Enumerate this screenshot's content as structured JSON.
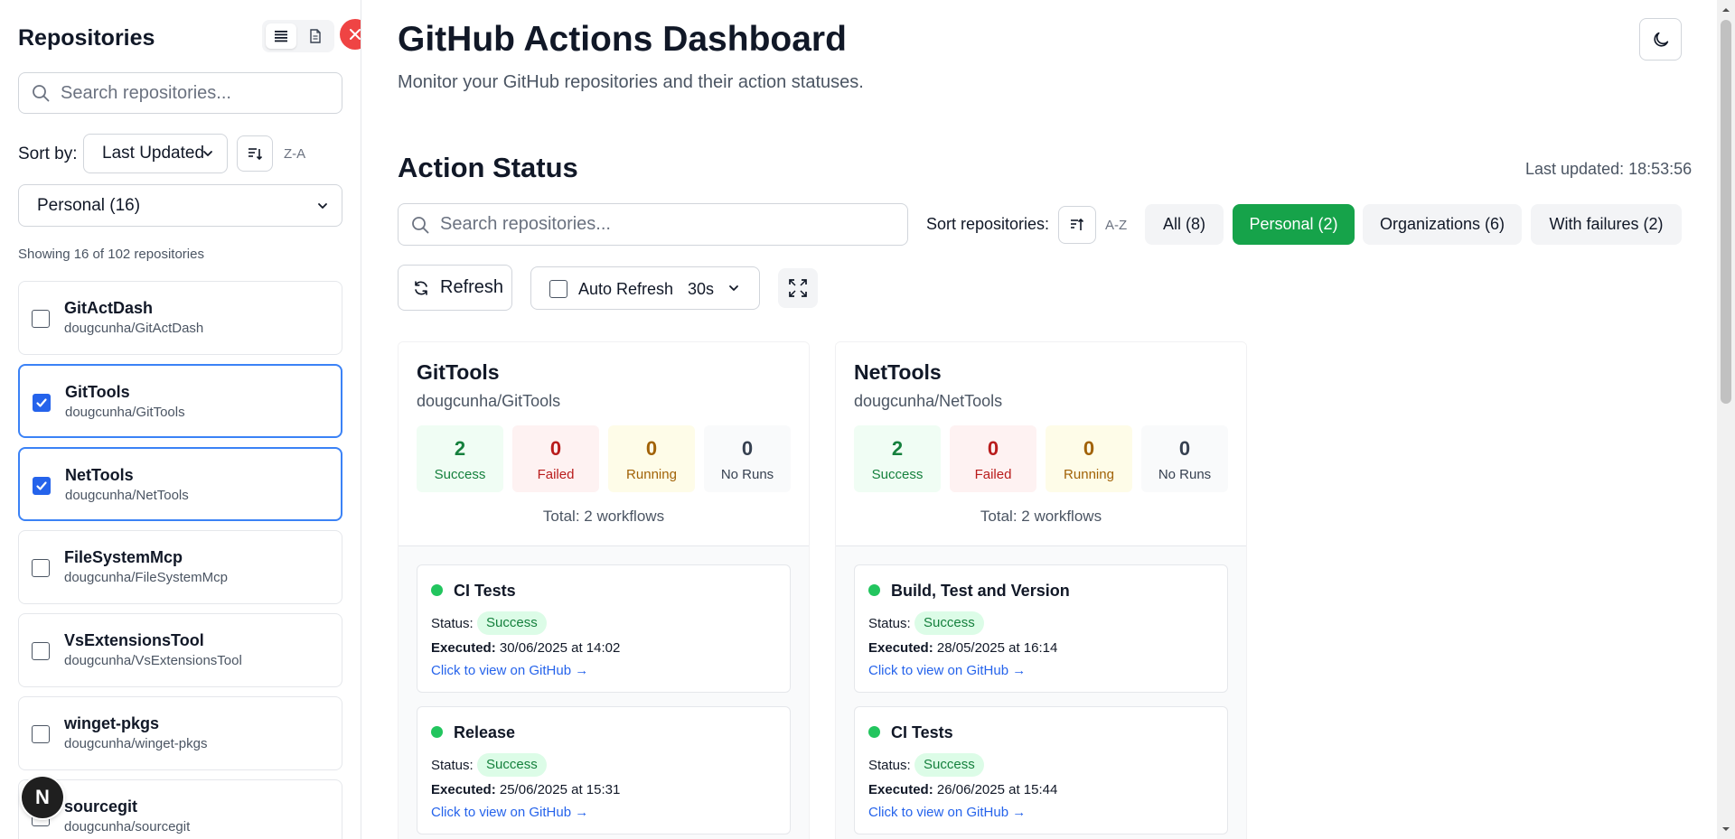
{
  "sidebar": {
    "title": "Repositories",
    "search_placeholder": "Search repositories...",
    "sort_label": "Sort by:",
    "sort_value": "Last Updated",
    "sort_direction": "Z-A",
    "filter_value": "Personal (16)",
    "showing_text": "Showing 16 of 102 repositories",
    "repos": [
      {
        "name": "GitActDash",
        "full": "dougcunha/GitActDash",
        "selected": false
      },
      {
        "name": "GitTools",
        "full": "dougcunha/GitTools",
        "selected": true
      },
      {
        "name": "NetTools",
        "full": "dougcunha/NetTools",
        "selected": true
      },
      {
        "name": "FileSystemMcp",
        "full": "dougcunha/FileSystemMcp",
        "selected": false
      },
      {
        "name": "VsExtensionsTool",
        "full": "dougcunha/VsExtensionsTool",
        "selected": false
      },
      {
        "name": "winget-pkgs",
        "full": "dougcunha/winget-pkgs",
        "selected": false
      },
      {
        "name": "sourcegit",
        "full": "dougcunha/sourcegit",
        "selected": false
      }
    ]
  },
  "avatar_letter": "N",
  "header": {
    "title": "GitHub Actions Dashboard",
    "subtitle": "Monitor your GitHub repositories and their action statuses."
  },
  "action_status": {
    "title": "Action Status",
    "last_updated": "Last updated: 18:53:56",
    "search_placeholder": "Search repositories...",
    "sort_label": "Sort repositories:",
    "sort_direction": "A-Z",
    "tabs": [
      {
        "label": "All (8)",
        "active": false
      },
      {
        "label": "Personal (2)",
        "active": true
      },
      {
        "label": "Organizations (6)",
        "active": false
      },
      {
        "label": "With failures (2)",
        "active": false
      }
    ],
    "refresh_label": "Refresh",
    "auto_refresh_label": "Auto Refresh",
    "auto_refresh_interval": "30s"
  },
  "cards": [
    {
      "name": "GitTools",
      "full": "dougcunha/GitTools",
      "stats": {
        "success": "2",
        "failed": "0",
        "running": "0",
        "no_runs": "0"
      },
      "stat_labels": {
        "success": "Success",
        "failed": "Failed",
        "running": "Running",
        "no_runs": "No Runs"
      },
      "total": "Total: 2 workflows",
      "workflows": [
        {
          "name": "CI Tests",
          "status_label": "Status:",
          "status": "Success",
          "executed_label": "Executed:",
          "executed": "30/06/2025 at 14:02",
          "link": "Click to view on GitHub →"
        },
        {
          "name": "Release",
          "status_label": "Status:",
          "status": "Success",
          "executed_label": "Executed:",
          "executed": "25/06/2025 at 15:31",
          "link": "Click to view on GitHub →"
        }
      ]
    },
    {
      "name": "NetTools",
      "full": "dougcunha/NetTools",
      "stats": {
        "success": "2",
        "failed": "0",
        "running": "0",
        "no_runs": "0"
      },
      "stat_labels": {
        "success": "Success",
        "failed": "Failed",
        "running": "Running",
        "no_runs": "No Runs"
      },
      "total": "Total: 2 workflows",
      "workflows": [
        {
          "name": "Build, Test and Version",
          "status_label": "Status:",
          "status": "Success",
          "executed_label": "Executed:",
          "executed": "28/05/2025 at 16:14",
          "link": "Click to view on GitHub →"
        },
        {
          "name": "CI Tests",
          "status_label": "Status:",
          "status": "Success",
          "executed_label": "Executed:",
          "executed": "26/06/2025 at 15:44",
          "link": "Click to view on GitHub →"
        }
      ]
    }
  ],
  "colors": {
    "accent_green": "#16a34a",
    "selected_border": "#3b82f6",
    "close_red": "#ef4444",
    "link_blue": "#2563eb"
  },
  "icons": [
    "list-icon",
    "document-icon",
    "close-icon",
    "search-icon",
    "sort-descending-icon",
    "chevron-down-icon",
    "sort-ascending-icon",
    "refresh-icon",
    "expand-icon",
    "moon-icon",
    "check-icon",
    "status-dot-icon"
  ]
}
